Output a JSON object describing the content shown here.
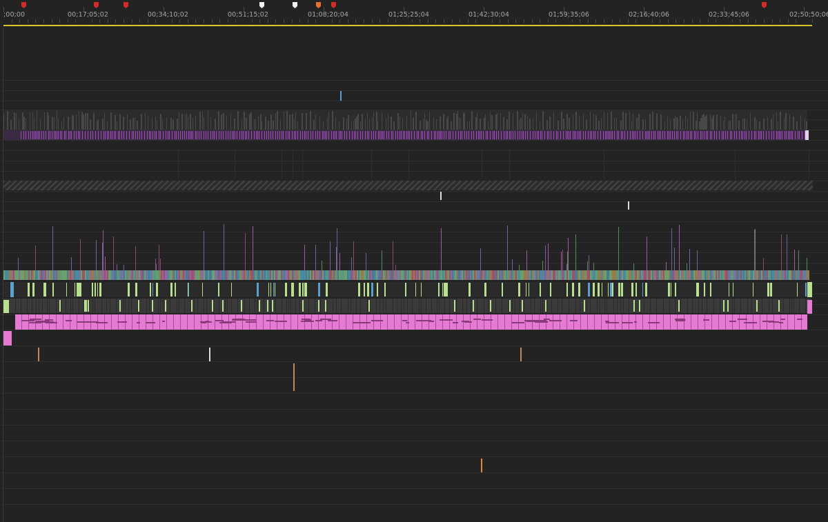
{
  "timecodes": [
    ";00;00",
    "00;17;05;02",
    "00;34;10;02",
    "00;51;15;02",
    "01;08;20;04",
    "01;25;25;04",
    "01;42;30;04",
    "01;59;35;06",
    "02;16;40;06",
    "02;33;45;06",
    "02;50;50;06"
  ],
  "markers": [
    {
      "color": "#d42a2a"
    },
    {
      "color": "#d42a2a"
    },
    {
      "color": "#d42a2a"
    },
    {
      "color": "#f2f2f2"
    },
    {
      "color": "#f2f2f2"
    },
    {
      "color": "#e8702a"
    },
    {
      "color": "#d42a2a"
    },
    {
      "color": "#d42a2a"
    }
  ],
  "colors": {
    "background": "#232323",
    "work_area": "#d9c62a",
    "video_clip": "#3f3f3f",
    "audio_purple": "#a04cc0",
    "audio_pink": "#e47ad2",
    "audio_green": "#b8e090",
    "audio_blue": "#5aa0d0",
    "hatched": "#3a3a3a"
  }
}
